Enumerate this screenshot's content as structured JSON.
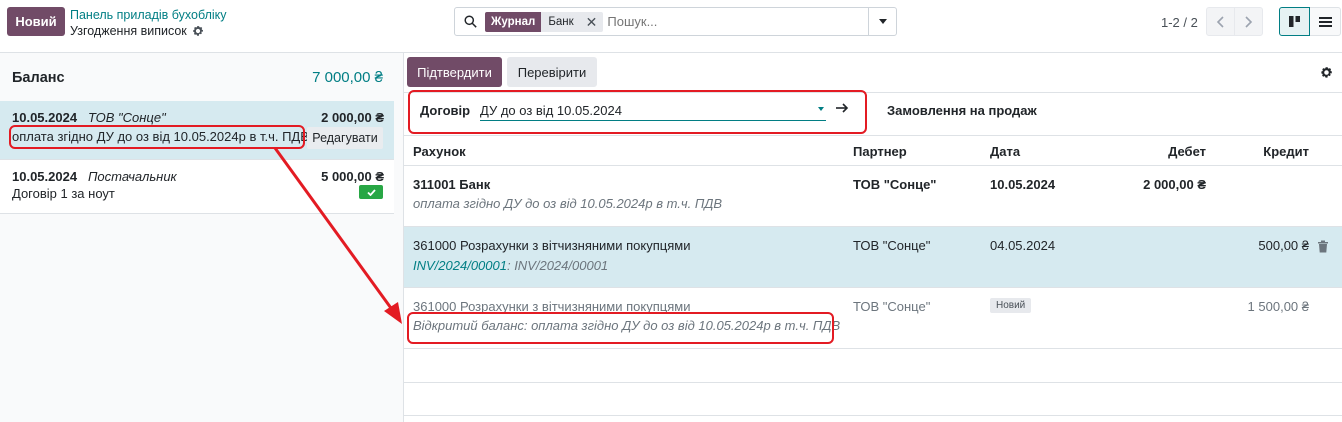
{
  "toolbar": {
    "new_label": "Новий",
    "breadcrumb_parent": "Панель приладів бухобліку",
    "breadcrumb_current": "Узгодження виписок",
    "search": {
      "facet_label": "Журнал",
      "facet_value": "Банк",
      "placeholder": "Пошук..."
    },
    "pager": "1-2 / 2"
  },
  "left_panel": {
    "balance_label": "Баланс",
    "balance_amount": "7 000,00 ₴",
    "statement_lines": [
      {
        "date": "10.05.2024",
        "partner": "ТОВ \"Сонце\"",
        "amount": "2 000,00 ₴",
        "label": "оплата згідно ДУ до оз від 10.05.2024р в т.ч. ПДВ",
        "action": "Редагувати",
        "selected": true
      },
      {
        "date": "10.05.2024",
        "partner": "Постачальник",
        "amount": "5 000,00 ₴",
        "label": "Договір 1 за ноут",
        "reconciled": true
      }
    ]
  },
  "right_panel": {
    "validate_label": "Підтвердити",
    "check_label": "Перевірити",
    "contract_label": "Договір",
    "contract_value": "ДУ до оз від 10.05.2024",
    "sale_order_label": "Замовлення на продаж",
    "columns": [
      "Рахунок",
      "Партнер",
      "Дата",
      "Дебет",
      "Кредит"
    ],
    "rows": [
      {
        "account": "311001 Банк",
        "sub": "оплата згідно ДУ до оз від 10.05.2024р в т.ч. ПДВ",
        "partner": "ТОВ \"Сонце\"",
        "date": "10.05.2024",
        "debit": "2 000,00 ₴",
        "credit": ""
      },
      {
        "account": "361000 Розрахунки з вітчизняними покупцями",
        "sub_link": "INV/2024/00001",
        "sub_rest": ": INV/2024/00001",
        "partner": "ТОВ \"Сонце\"",
        "date": "04.05.2024",
        "debit": "",
        "credit": "500,00 ₴"
      },
      {
        "account": "361000 Розрахунки з вітчизняними покупцями",
        "sub": "Відкритий баланс: оплата згідно ДУ до оз від 10.05.2024р в т.ч. ПДВ",
        "partner": "ТОВ \"Сонце\"",
        "date_badge": "Новий",
        "debit": "",
        "credit": "1 500,00 ₴"
      }
    ]
  },
  "colors": {
    "primary": "#714b67",
    "accent": "#017e84",
    "selected_row": "#d6eaf0",
    "annotation": "#e31b23",
    "success": "#28a745"
  },
  "icons": [
    "search-icon",
    "close-icon",
    "caret-down-icon",
    "gear-icon",
    "chevron-left-icon",
    "chevron-right-icon",
    "kanban-view-icon",
    "list-view-icon",
    "check-icon",
    "arrow-right-icon",
    "trash-icon"
  ]
}
